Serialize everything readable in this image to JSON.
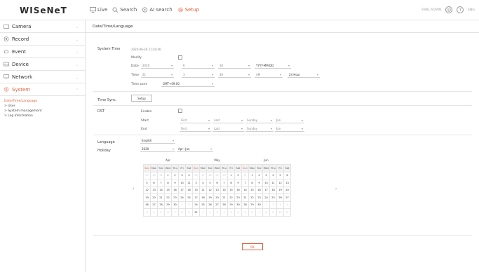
{
  "header": {
    "logo": "WISeNeT",
    "nav": [
      {
        "label": "Live",
        "icon": "monitor-icon"
      },
      {
        "label": "Search",
        "icon": "search-icon"
      },
      {
        "label": "AI search",
        "icon": "ai-search-icon"
      },
      {
        "label": "Setup",
        "icon": "gear-icon"
      }
    ],
    "user": "SNNL.ADMIN",
    "lang": "ENG",
    "accent": "#e2603a"
  },
  "sidebar": {
    "items": [
      {
        "label": "Camera",
        "icon": "camera-icon"
      },
      {
        "label": "Record",
        "icon": "record-icon"
      },
      {
        "label": "Event",
        "icon": "bell-icon"
      },
      {
        "label": "Device",
        "icon": "device-icon"
      },
      {
        "label": "Network",
        "icon": "network-icon"
      },
      {
        "label": "System",
        "icon": "gear-icon"
      }
    ],
    "sub": [
      "Date/Time/Language",
      "User",
      "System management",
      "Log Information"
    ]
  },
  "page": {
    "title": "Date/Time/Language",
    "system_time_label": "System Time",
    "system_time_value": "2020-06-30 21:30:46",
    "modify_label": "Modify",
    "date_label": "Date",
    "date_year": "2020",
    "date_month": "6",
    "date_day": "30",
    "date_format": "YYYY-MM-DD",
    "time_label": "Time",
    "time_h": "21",
    "time_m": "3",
    "time_s": "46",
    "time_ampm": "AM",
    "time_format": "24 Hour",
    "timezone_label": "Time zone",
    "timezone_value": "GMT+09:00",
    "time_sync_label": "Time Sync.",
    "setup_button": "Setup",
    "dst_label": "DST",
    "enable_label": "Enable",
    "start_label": "Start",
    "end_label": "End",
    "dst_start": [
      "First",
      "Last",
      "Sunday",
      "Jan"
    ],
    "dst_end": [
      "First",
      "Last",
      "Sunday",
      "Jan"
    ],
    "language_label": "Language",
    "language_value": "English",
    "holiday_label": "Holiday",
    "holiday_year": "2020",
    "holiday_range": "Apr~Jun",
    "ok_button": "OK"
  },
  "calendar": {
    "weekdays": [
      "Sun",
      "Mon",
      "Tue",
      "Wed",
      "Thu",
      "Fri",
      "Sat"
    ],
    "months": [
      {
        "name": "Apr",
        "days": [
          "29",
          "30",
          "31",
          "1",
          "2",
          "3",
          "4",
          "5",
          "6",
          "7",
          "8",
          "9",
          "10",
          "11",
          "12",
          "13",
          "14",
          "15",
          "16",
          "17",
          "18",
          "19",
          "20",
          "21",
          "22",
          "23",
          "24",
          "25",
          "26",
          "27",
          "28",
          "29",
          "30",
          "1",
          "2",
          "3",
          "4",
          "5",
          "6",
          "7",
          "8",
          "9"
        ],
        "muted_before": 3,
        "muted_after_index": 33
      },
      {
        "name": "May",
        "days": [
          "26",
          "27",
          "28",
          "29",
          "30",
          "1",
          "2",
          "3",
          "4",
          "5",
          "6",
          "7",
          "8",
          "9",
          "10",
          "11",
          "12",
          "13",
          "14",
          "15",
          "16",
          "17",
          "18",
          "19",
          "20",
          "21",
          "22",
          "23",
          "24",
          "25",
          "26",
          "27",
          "28",
          "29",
          "30",
          "31",
          "1",
          "2",
          "3",
          "4",
          "5",
          "6"
        ],
        "muted_before": 5,
        "muted_after_index": 36
      },
      {
        "name": "Jun",
        "days": [
          "31",
          "1",
          "2",
          "3",
          "4",
          "5",
          "6",
          "7",
          "8",
          "9",
          "10",
          "11",
          "12",
          "13",
          "14",
          "15",
          "16",
          "17",
          "18",
          "19",
          "20",
          "21",
          "22",
          "23",
          "24",
          "25",
          "26",
          "27",
          "28",
          "29",
          "30",
          "1",
          "2",
          "3",
          "4",
          "5",
          "6",
          "7",
          "8",
          "9",
          "10",
          "11"
        ],
        "muted_before": 1,
        "muted_after_index": 31
      }
    ]
  }
}
